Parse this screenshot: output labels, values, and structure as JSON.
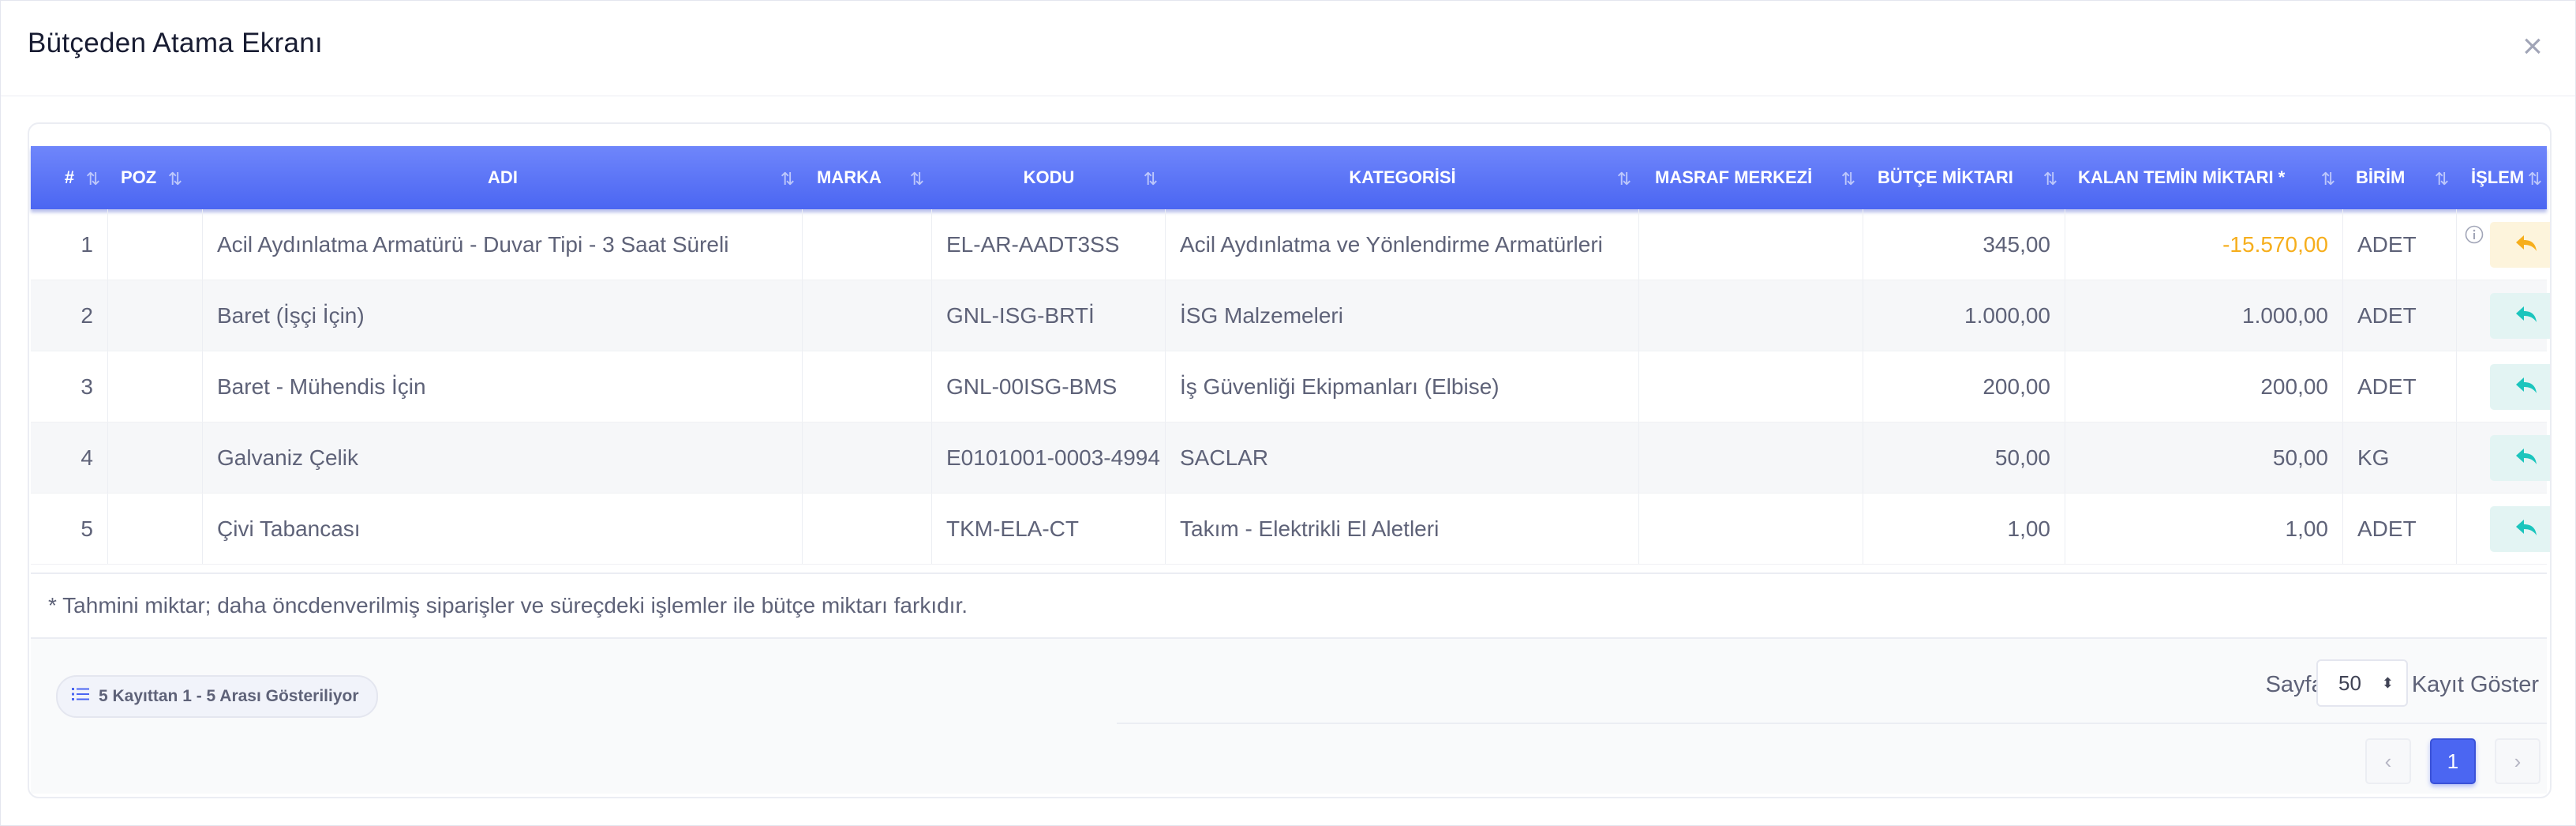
{
  "modal": {
    "title": "Bütçeden Atama Ekranı",
    "close_label": "×"
  },
  "table": {
    "columns": [
      "#",
      "POZ",
      "ADI",
      "MARKA",
      "KODU",
      "KATEGORİSİ",
      "MASRAF MERKEZİ",
      "BÜTÇE MİKTARI",
      "KALAN TEMİN MİKTARI *",
      "BİRİM",
      "İŞLEM"
    ],
    "sort_icon": "⇅",
    "rows": [
      {
        "no": "1",
        "poz": "",
        "adi": "Acil Aydınlatma Armatürü - Duvar Tipi - 3 Saat Süreli",
        "marka": "",
        "kodu": "EL-AR-AADT3SS",
        "kategori": "Acil Aydınlatma ve Yönlendirme Armatürleri",
        "masraf": "",
        "butce": "345,00",
        "kalan": "-15.570,00",
        "birim": "ADET",
        "kalan_warning": true
      },
      {
        "no": "2",
        "poz": "",
        "adi": "Baret (İşçi İçin)",
        "marka": "",
        "kodu": "GNL-ISG-BRTİ",
        "kategori": "İSG Malzemeleri",
        "masraf": "",
        "butce": "1.000,00",
        "kalan": "1.000,00",
        "birim": "ADET",
        "kalan_warning": false
      },
      {
        "no": "3",
        "poz": "",
        "adi": "Baret - Mühendis İçin",
        "marka": "",
        "kodu": "GNL-00ISG-BMS",
        "kategori": "İş Güvenliği Ekipmanları (Elbise)",
        "masraf": "",
        "butce": "200,00",
        "kalan": "200,00",
        "birim": "ADET",
        "kalan_warning": false
      },
      {
        "no": "4",
        "poz": "",
        "adi": "Galvaniz Çelik",
        "marka": "",
        "kodu": "E0101001-0003-4994",
        "kategori": "SACLAR",
        "masraf": "",
        "butce": "50,00",
        "kalan": "50,00",
        "birim": "KG",
        "kalan_warning": false
      },
      {
        "no": "5",
        "poz": "",
        "adi": "Çivi Tabancası",
        "marka": "",
        "kodu": "TKM-ELA-CT",
        "kategori": "Takım - Elektrikli El Aletleri",
        "masraf": "",
        "butce": "1,00",
        "kalan": "1,00",
        "birim": "ADET",
        "kalan_warning": false
      }
    ],
    "action_icon": "reply-icon",
    "note": "* Tahmini miktar; daha öncdenverilmiş siparişler ve süreçdeki işlemler ile bütçe miktarı farkıdır."
  },
  "footer": {
    "record_count": "5 Kayıttan 1 - 5 Arası Gösteriliyor",
    "page_size_prefix": "Sayfada",
    "page_size_value": "50",
    "page_size_suffix": "Kayıt Göster",
    "pager": {
      "prev": "‹",
      "current": "1",
      "next": "›"
    }
  },
  "colors": {
    "header": "#4b66f2",
    "warning": "#f6ae1c",
    "teal": "#1bc5bd"
  }
}
